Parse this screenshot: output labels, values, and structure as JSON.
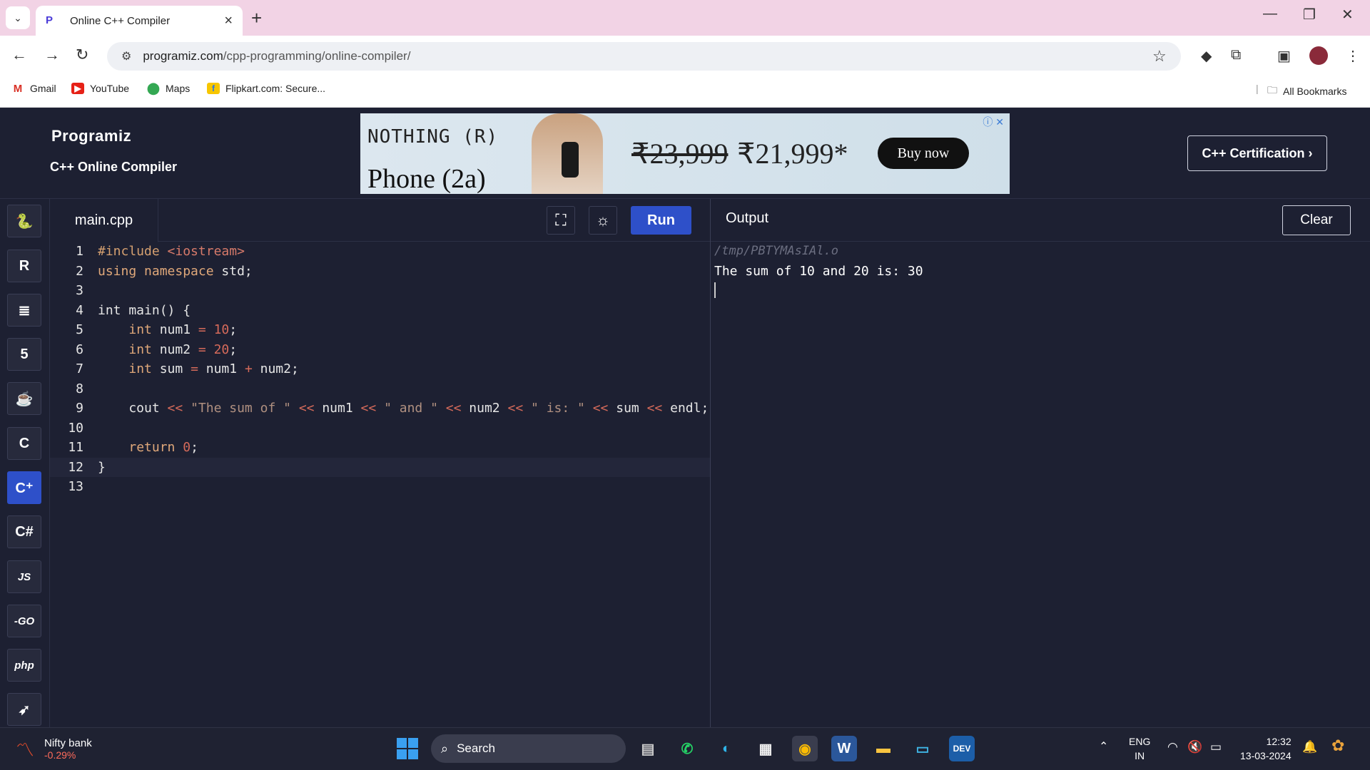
{
  "browser": {
    "tab_title": "Online C++ Compiler",
    "url_domain": "programiz.com",
    "url_path": "/cpp-programming/online-compiler/",
    "bookmarks": [
      "Gmail",
      "YouTube",
      "Maps",
      "Flipkart.com: Secure..."
    ],
    "all_bookmarks": "All Bookmarks"
  },
  "site": {
    "logo": "Programiz",
    "subtitle": "C++ Online Compiler",
    "certification": "C++ Certification ›"
  },
  "ad": {
    "brand": "NOTHING (R)",
    "product": "Phone (2a)",
    "old_price": "₹23,999",
    "new_price": "₹21,999*",
    "cta": "Buy now"
  },
  "sidebar": {
    "js_label": "JS",
    "go_label": "-GO",
    "php_label": "php"
  },
  "editor": {
    "filename": "main.cpp",
    "run_label": "Run",
    "line_numbers": [
      "1",
      "2",
      "3",
      "4",
      "5",
      "6",
      "7",
      "8",
      "9",
      "10",
      "11",
      "12",
      "13"
    ]
  },
  "output": {
    "title": "Output",
    "clear_label": "Clear",
    "path": "/tmp/PBTYMAsIAl.o",
    "text": "The sum of 10 and 20 is: 30"
  },
  "taskbar": {
    "market_name": "Nifty bank",
    "market_change": "-0.29%",
    "search_label": "Search",
    "lang_top": "ENG",
    "lang_bottom": "IN",
    "time": "12:32",
    "date": "13-03-2024"
  }
}
